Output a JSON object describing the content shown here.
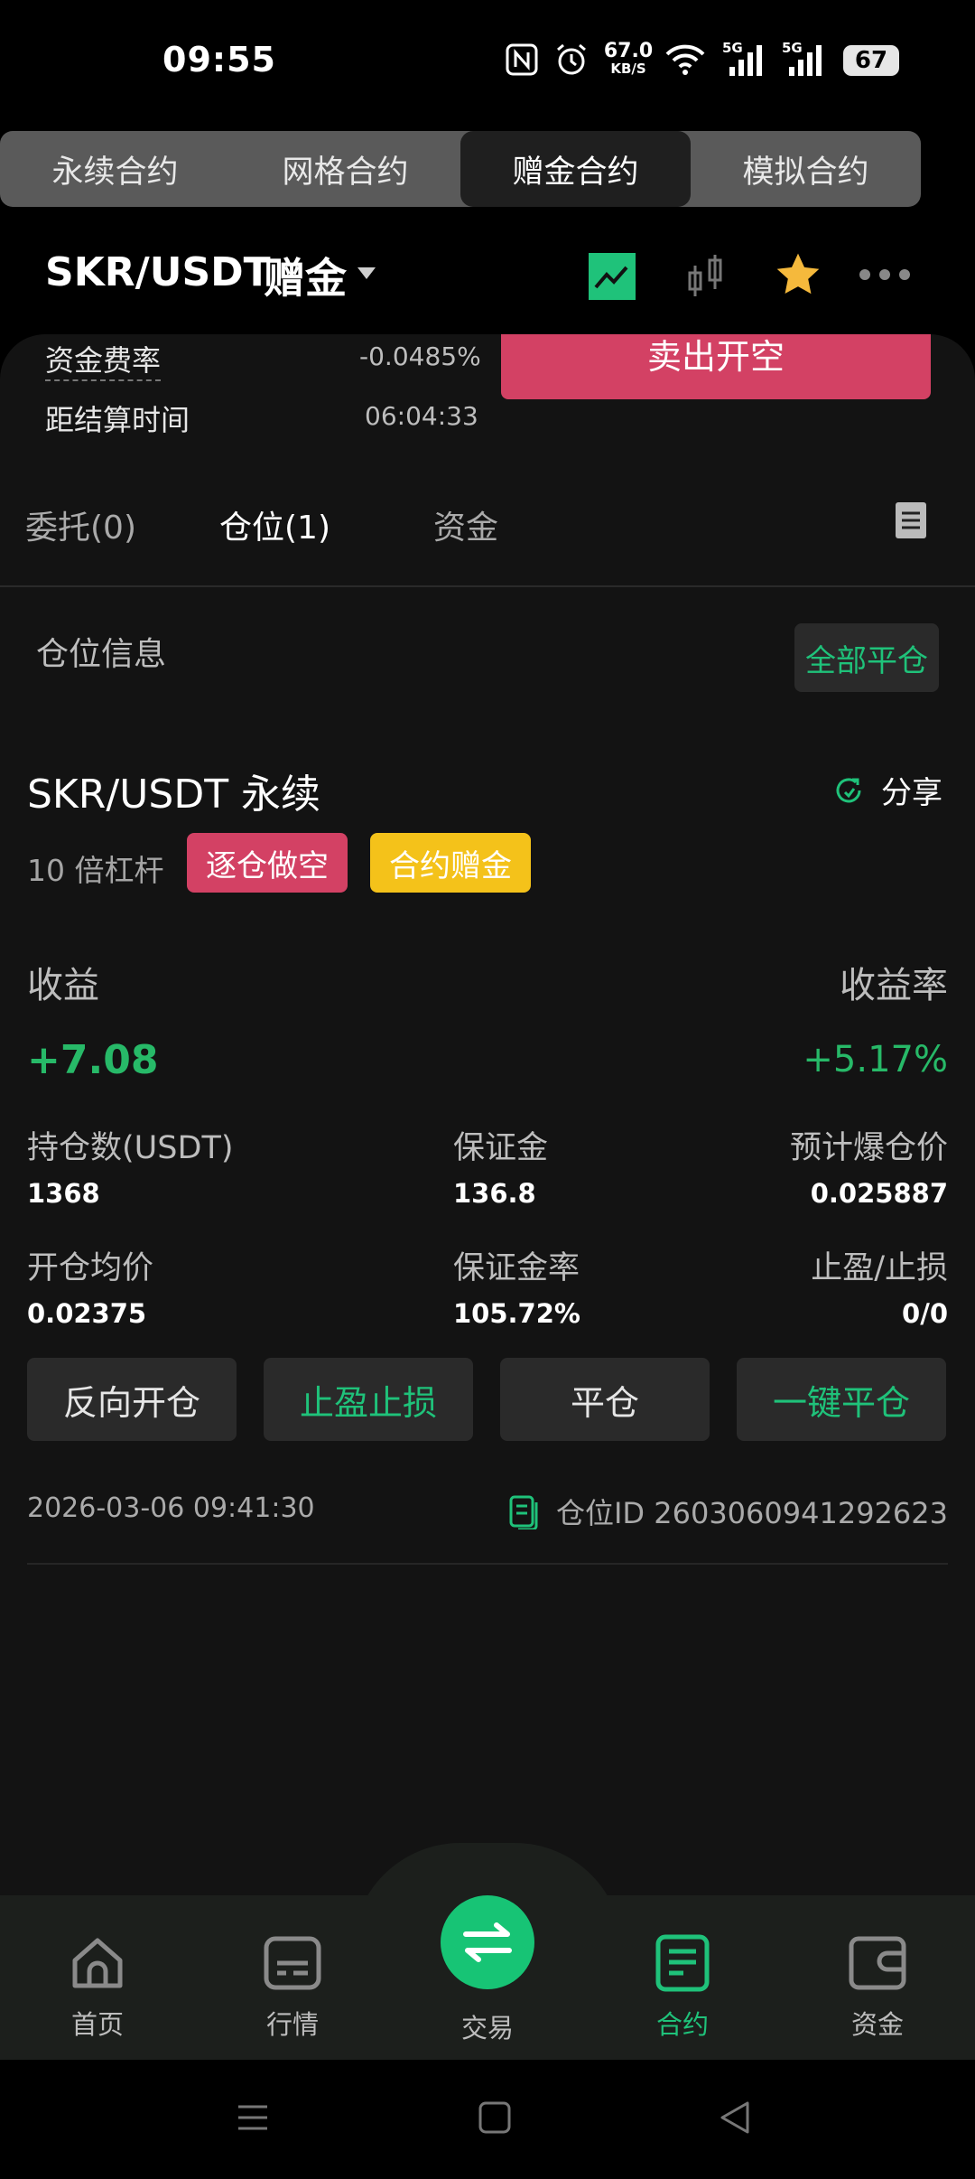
{
  "status_bar": {
    "time": "09:55",
    "net_speed": "67.0",
    "net_unit": "KB/S",
    "net_type_1": "5G",
    "net_type_2": "5G",
    "battery": "67"
  },
  "contract_tabs": [
    {
      "label": "永续合约",
      "active": false
    },
    {
      "label": "网格合约",
      "active": false
    },
    {
      "label": "赠金合约",
      "active": true
    },
    {
      "label": "模拟合约",
      "active": false
    }
  ],
  "header": {
    "pair": "SKR/USDT",
    "tag": "赠金",
    "icons": [
      "chart-line-icon",
      "candlestick-icon",
      "star-icon",
      "more-icon"
    ]
  },
  "info": {
    "funding_rate_label": "资金费率",
    "funding_rate_value": "-0.0485%",
    "settlement_label": "距结算时间",
    "settlement_value": "06:04:33",
    "sell_button": "卖出开空"
  },
  "position_tabs": [
    {
      "label": "委托(0)",
      "active": false
    },
    {
      "label": "仓位(1)",
      "active": true
    },
    {
      "label": "资金",
      "active": false
    }
  ],
  "position_section": {
    "title": "仓位信息",
    "close_all": "全部平仓"
  },
  "position": {
    "pair": "SKR/USDT 永续",
    "share": "分享",
    "leverage": "10 倍杠杆",
    "badge_mode": "逐仓做空",
    "badge_bonus": "合约赠金",
    "pnl_label": "收益",
    "pnl_rate_label": "收益率",
    "pnl_value": "+7.08",
    "pnl_rate": "+5.17%",
    "fields": {
      "size_label": "持仓数(USDT)",
      "size_value": "1368",
      "margin_label": "保证金",
      "margin_value": "136.8",
      "liq_label": "预计爆仓价",
      "liq_value": "0.025887",
      "entry_label": "开仓均价",
      "entry_value": "0.02375",
      "margin_rate_label": "保证金率",
      "margin_rate_value": "105.72%",
      "tpsl_label": "止盈/止损",
      "tpsl_value": "0/0"
    },
    "buttons": {
      "reverse": "反向开仓",
      "tpsl": "止盈止损",
      "close": "平仓",
      "quick_close": "一键平仓"
    },
    "time": "2026-03-06 09:41:30",
    "id": "仓位ID 2603060941292623"
  },
  "bottom_nav": [
    {
      "label": "首页",
      "icon": "home-icon",
      "active": false
    },
    {
      "label": "行情",
      "icon": "market-icon",
      "active": false
    },
    {
      "label": "交易",
      "icon": "swap-icon",
      "active": false
    },
    {
      "label": "合约",
      "icon": "contract-icon",
      "active": true
    },
    {
      "label": "资金",
      "icon": "wallet-icon",
      "active": false
    }
  ],
  "colors": {
    "accent_green": "#1fc27a",
    "sell_red": "#d34164",
    "bonus_yellow": "#f4c21a"
  }
}
